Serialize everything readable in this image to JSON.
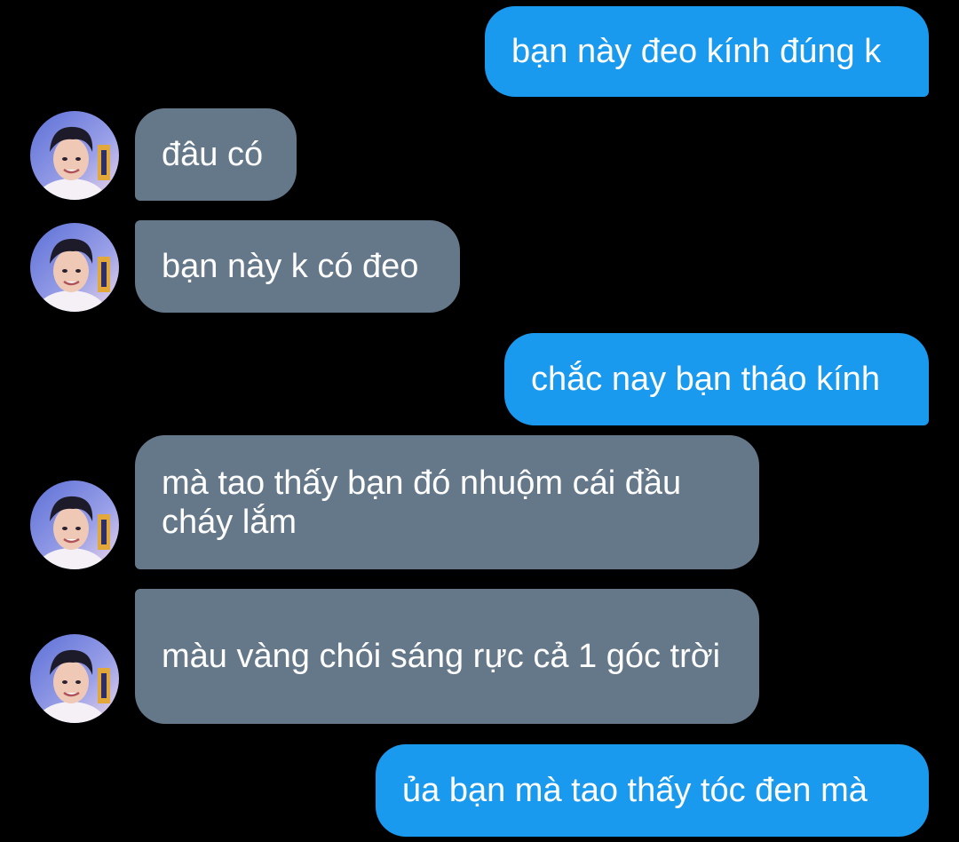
{
  "colors": {
    "background": "#000000",
    "sent_bubble": "#1a9aef",
    "received_bubble": "#65788a",
    "text": "#ffffff"
  },
  "messages": [
    {
      "side": "sent",
      "text": "bạn này đeo kính đúng k"
    },
    {
      "side": "received",
      "text": "đâu có"
    },
    {
      "side": "received",
      "text": "bạn này k có đeo"
    },
    {
      "side": "sent",
      "text": "chắc nay bạn tháo kính"
    },
    {
      "side": "received",
      "text": "mà tao thấy bạn đó nhuộm cái đầu cháy lắm"
    },
    {
      "side": "received",
      "text": "màu vàng chói sáng rực cả 1 góc trời"
    },
    {
      "side": "sent",
      "text": "ủa bạn mà tao thấy tóc đen mà"
    }
  ],
  "contact": {
    "avatar_icon": "contact-avatar-photo"
  }
}
